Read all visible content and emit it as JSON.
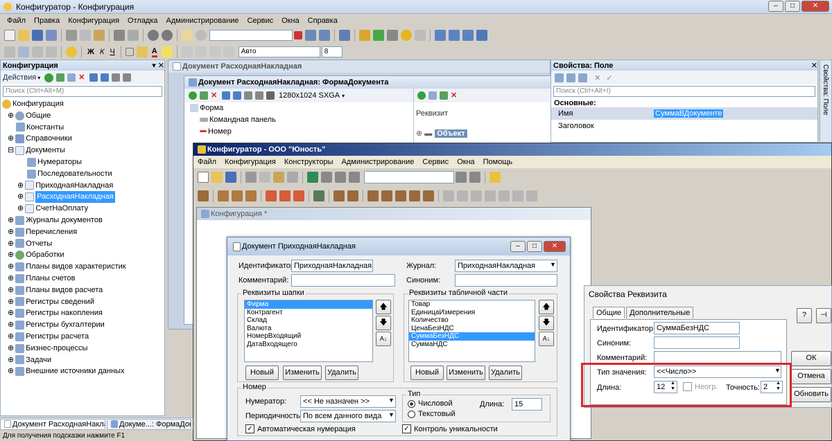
{
  "main_window": {
    "title": "Конфигуратор - Конфигурация",
    "menu": [
      "Файл",
      "Правка",
      "Конфигурация",
      "Отладка",
      "Администрирование",
      "Сервис",
      "Окна",
      "Справка"
    ],
    "font_name": "Авто",
    "font_size": "8"
  },
  "config_panel": {
    "title": "Конфигурация",
    "actions_label": "Действия",
    "search_placeholder": "Поиск (Ctrl+Alt+M)",
    "tree": [
      "Конфигурация",
      "Общие",
      "Константы",
      "Справочники",
      "Документы",
      "Нумераторы",
      "Последовательности",
      "ПриходнаяНакладная",
      "РасходнаяНакладная",
      "СчетНаОплату",
      "Журналы документов",
      "Перечисления",
      "Отчеты",
      "Обработки",
      "Планы видов характеристик",
      "Планы счетов",
      "Планы видов расчета",
      "Регистры сведений",
      "Регистры накопления",
      "Регистры бухгалтерии",
      "Регистры расчета",
      "Бизнес-процессы",
      "Задачи",
      "Внешние источники данных"
    ]
  },
  "doc_window": {
    "title": "Документ РасходнаяНакладная",
    "form_title": "Документ РасходнаяНакладная: ФормаДокумента",
    "resolution": "1280x1024 SXGA",
    "form_tree": [
      "Форма",
      "Командная панель",
      "Номер"
    ],
    "rekvizit_header": "Реквизит",
    "object_label": "Объект"
  },
  "properties_panel": {
    "title": "Свойства: Поле",
    "search_placeholder": "Поиск (Ctrl+Alt+I)",
    "section": "Основные:",
    "name_label": "Имя",
    "name_value": "СуммаВДокументе",
    "caption_label": "Заголовок",
    "side_tab": "Свойства: Поле"
  },
  "old_window": {
    "title": "Конфигуратор - ООО \"Юность\"",
    "menu": [
      "Файл",
      "Конфигурация",
      "Конструкторы",
      "Администрирование",
      "Сервис",
      "Окна",
      "Помощь"
    ],
    "config_title": "Конфигурация *"
  },
  "doc_dialog": {
    "title": "Документ ПриходнаяНакладная",
    "id_label": "Идентификатор:",
    "id_value": "ПриходнаяНакладная",
    "journal_label": "Журнал:",
    "journal_value": "ПриходнаяНакладная",
    "comment_label": "Комментарий:",
    "synonym_label": "Синоним:",
    "header_group": "Реквизиты шапки",
    "header_items": [
      "Фирма",
      "Контрагент",
      "Склад",
      "Валюта",
      "НомерВходящий",
      "ДатаВходящего"
    ],
    "table_group": "Реквизиты табличной части",
    "table_items": [
      "Товар",
      "ЕдиницаИзмерения",
      "Количество",
      "ЦенаБезНДС",
      "СуммаБезНДС",
      "СуммаНДС"
    ],
    "btn_new": "Новый",
    "btn_edit": "Изменить",
    "btn_delete": "Удалить",
    "number_group": "Номер",
    "numerator_label": "Нумератор:",
    "numerator_value": "<< Не назначен >>",
    "period_label": "Периодичность:",
    "period_value": "По всем данного вида",
    "auto_num": "Автоматическая нумерация",
    "type_group": "Тип",
    "type_numeric": "Числовой",
    "type_text": "Текстовый",
    "length_label": "Длина:",
    "length_value": "15",
    "uniqueness": "Контроль уникальности"
  },
  "req_dialog": {
    "title": "Свойства Реквизита",
    "tab_general": "Общие",
    "tab_extra": "Дополнительные",
    "id_label": "Идентификатор:",
    "id_value": "СуммаБезНДС",
    "synonym_label": "Синоним:",
    "comment_label": "Комментарий:",
    "type_label": "Тип значения:",
    "type_value": "<<Число>>",
    "length_label": "Длина:",
    "length_value": "12",
    "nonneg_label": "Неогр.",
    "precision_label": "Точность:",
    "precision_value": "2",
    "btn_ok": "ОК",
    "btn_cancel": "Отмена",
    "btn_refresh": "Обновить"
  },
  "taskbar": {
    "tabs": [
      "Документ РасходнаяНакла...",
      "Докуме...: ФормаДокум..."
    ],
    "status": "Для получения подсказки нажмите F1"
  },
  "colors": {
    "accent": "#3399ff",
    "highlight": "#e0242c",
    "title_grad": "#dfe9f5"
  }
}
